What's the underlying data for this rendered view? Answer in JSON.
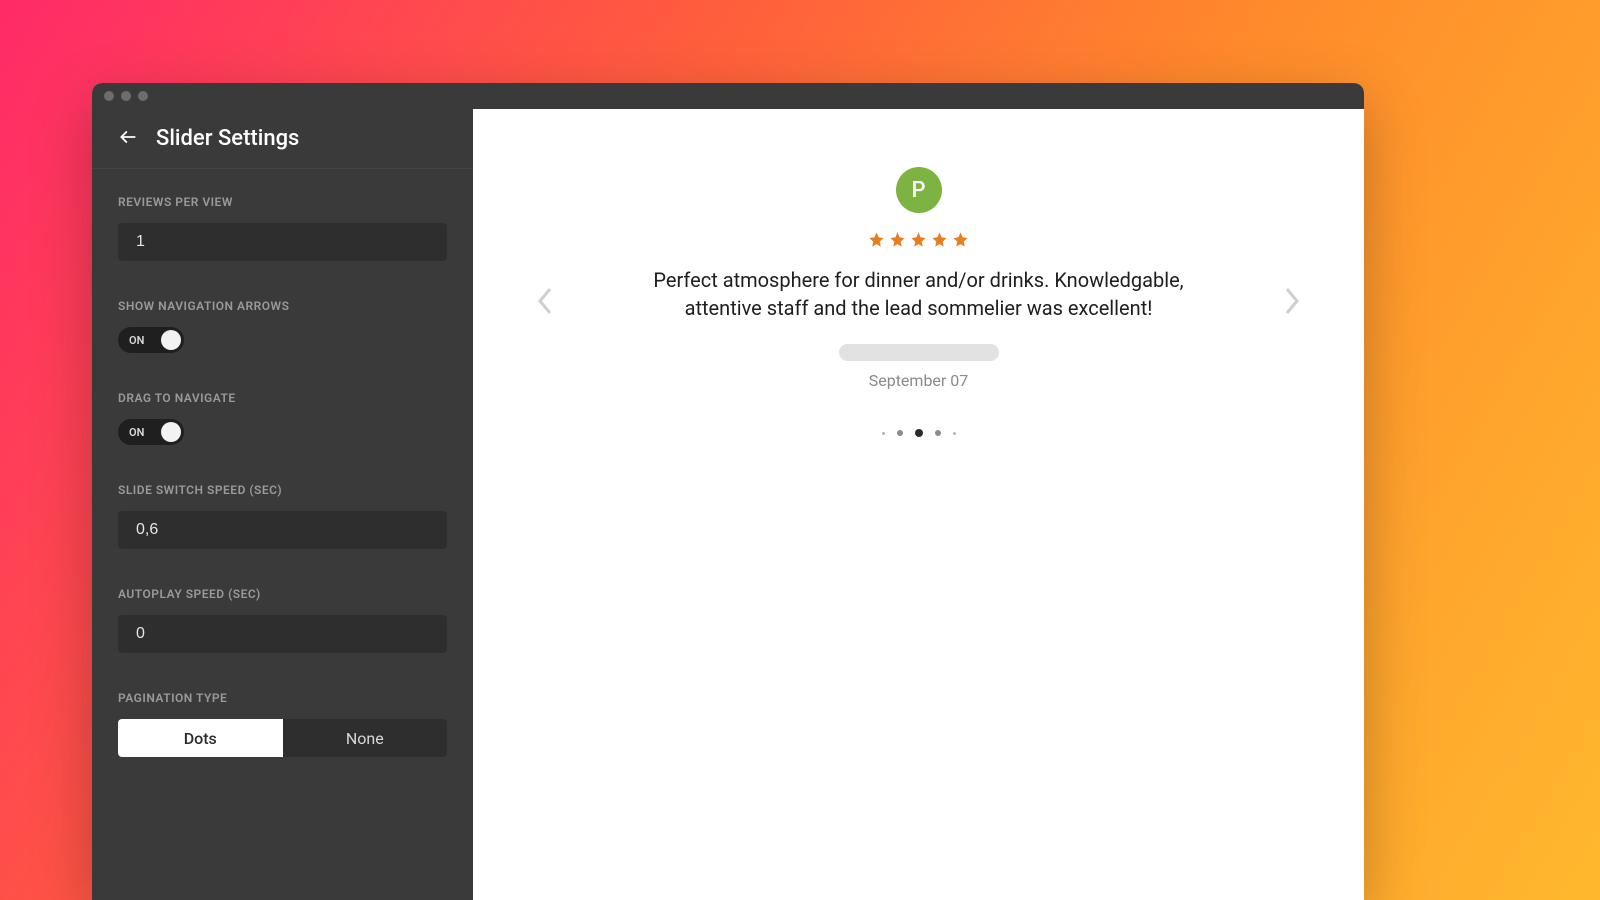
{
  "header": {
    "title": "Slider Settings"
  },
  "fields": {
    "reviews_per_view": {
      "label": "REVIEWS PER VIEW",
      "value": "1"
    },
    "show_nav_arrows": {
      "label": "SHOW NAVIGATION ARROWS",
      "state": "ON"
    },
    "drag_to_navigate": {
      "label": "DRAG TO NAVIGATE",
      "state": "ON"
    },
    "slide_switch_speed": {
      "label": "SLIDE SWITCH SPEED (SEC)",
      "value": "0,6"
    },
    "autoplay_speed": {
      "label": "AUTOPLAY SPEED (SEC)",
      "value": "0"
    },
    "pagination_type": {
      "label": "PAGINATION TYPE",
      "options": [
        "Dots",
        "None"
      ],
      "selected": "Dots"
    }
  },
  "preview": {
    "avatar_letter": "P",
    "rating": 5,
    "text": "Perfect atmosphere for dinner and/or drinks. Knowledgable, attentive staff and the lead sommelier was excellent!",
    "date": "September 07",
    "pagination": {
      "count": 5,
      "active_index": 2
    }
  },
  "colors": {
    "avatar_bg": "#7cb342",
    "star_fill": "#e67e22"
  }
}
